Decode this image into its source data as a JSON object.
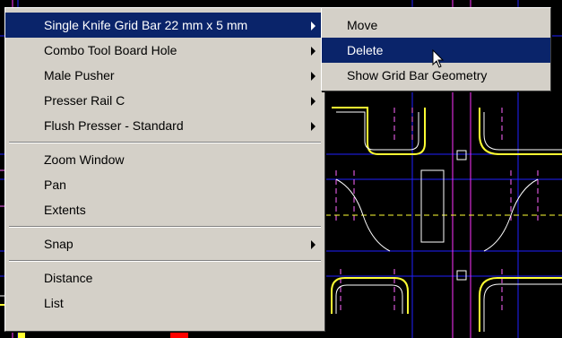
{
  "context_menu": {
    "items": [
      {
        "label": "Single Knife Grid Bar 22 mm x 5 mm",
        "submenu": true,
        "highlighted": true
      },
      {
        "label": "Combo Tool Board Hole",
        "submenu": true
      },
      {
        "label": "Male Pusher",
        "submenu": true
      },
      {
        "label": "Presser Rail C",
        "submenu": true
      },
      {
        "label": "Flush Presser - Standard",
        "submenu": true
      },
      {
        "label": "Zoom Window"
      },
      {
        "label": "Pan"
      },
      {
        "label": "Extents"
      },
      {
        "label": "Snap",
        "submenu": true
      },
      {
        "label": "Distance"
      },
      {
        "label": "List"
      }
    ]
  },
  "submenu": {
    "items": [
      {
        "label": "Move"
      },
      {
        "label": "Delete",
        "highlighted": true
      },
      {
        "label": "Show Grid Bar Geometry"
      }
    ]
  },
  "colors": {
    "menu_bg": "#d4d0c8",
    "highlight": "#0a246a",
    "cad_background": "#000000",
    "cad_lines_white": "#ffffff",
    "cad_lines_yellow": "#ffff00",
    "cad_lines_blue": "#0000ff",
    "cad_lines_magenta": "#ff00ff",
    "cad_lines_red": "#ff0000"
  },
  "icons": [
    "arrow-cursor-icon",
    "submenu-arrow-icon"
  ]
}
